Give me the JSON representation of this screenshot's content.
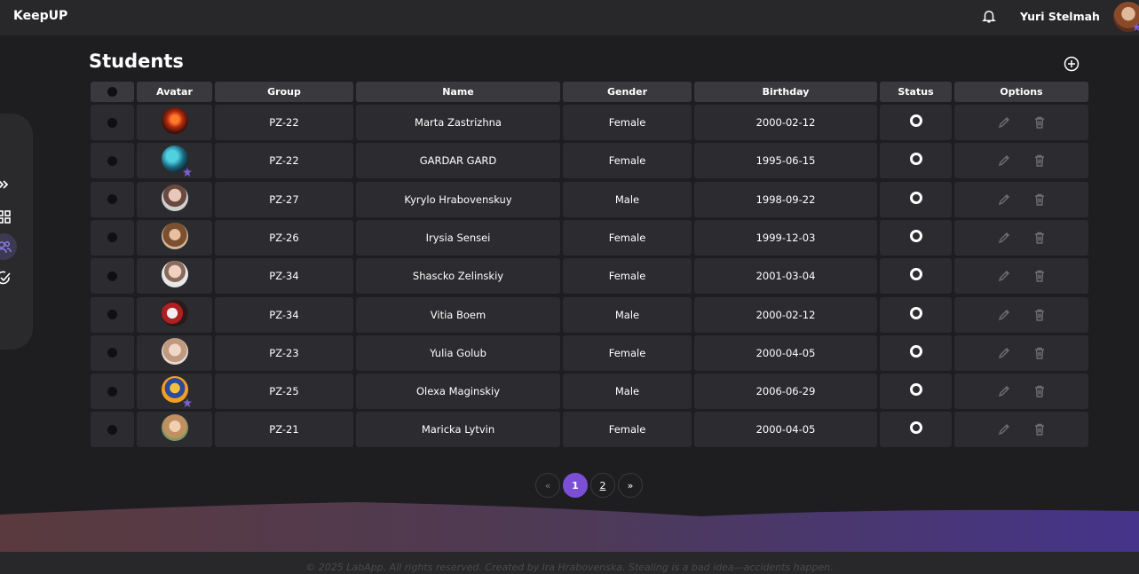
{
  "app": {
    "name": "KeepUP"
  },
  "user": {
    "name": "Yuri Stelmah"
  },
  "page": {
    "title": "Students"
  },
  "table": {
    "headers": [
      "Avatar",
      "Group",
      "Name",
      "Gender",
      "Birthday",
      "Status",
      "Options"
    ],
    "rows": [
      {
        "group": "PZ-22",
        "name": "Marta Zastrizhna",
        "gender": "Female",
        "birthday": "2000-02-12"
      },
      {
        "group": "PZ-22",
        "name": "GARDAR GARD",
        "gender": "Female",
        "birthday": "1995-06-15"
      },
      {
        "group": "PZ-27",
        "name": "Kyrylo Hrabovenskuy",
        "gender": "Male",
        "birthday": "1998-09-22"
      },
      {
        "group": "PZ-26",
        "name": "Irysia Sensei",
        "gender": "Female",
        "birthday": "1999-12-03"
      },
      {
        "group": "PZ-34",
        "name": "Shascko Zelinskiy",
        "gender": "Female",
        "birthday": "2001-03-04"
      },
      {
        "group": "PZ-34",
        "name": "Vitia Boem",
        "gender": "Male",
        "birthday": "2000-02-12"
      },
      {
        "group": "PZ-23",
        "name": "Yulia Golub",
        "gender": "Female",
        "birthday": "2000-04-05"
      },
      {
        "group": "PZ-25",
        "name": "Olexa Maginskiy",
        "gender": "Male",
        "birthday": "2006-06-29"
      },
      {
        "group": "PZ-21",
        "name": "Maricka Lytvin",
        "gender": "Female",
        "birthday": "2000-04-05"
      }
    ]
  },
  "pagination": {
    "prev": "«",
    "pages": [
      "1",
      "2"
    ],
    "current": "1",
    "next": "»"
  },
  "footer": {
    "text": "© 2025 LabApp. All rights reserved. Created by Ira Hrabovenska. Stealing is a bad idea—accidents happen."
  },
  "colors": {
    "accent": "#7b4fd6",
    "background": "#1e1e21",
    "cell": "#2c2c30",
    "header_cell": "#3a3a3e"
  }
}
